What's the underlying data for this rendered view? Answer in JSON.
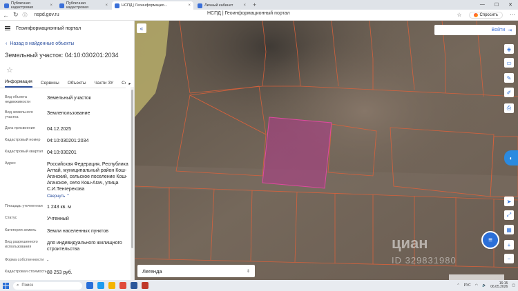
{
  "browser": {
    "tabs": [
      {
        "title": "Публичная кадастровая"
      },
      {
        "title": "Публичная кадастровая"
      },
      {
        "title": "НСПД | Геоинформацио...",
        "active": true
      },
      {
        "title": "Личный кабинет"
      }
    ],
    "url": "nspd.gov.ru",
    "page_title": "НСПД | Геоинформационный портал",
    "ask_label": "Спросить"
  },
  "panel": {
    "portal_name": "Геоинформационный портал",
    "back_label": "Назад в найденные объекты",
    "title": "Земельный участок: 04:10:030201:2034",
    "tabs": [
      "Информация",
      "Сервисы",
      "Объекты",
      "Части ЗУ",
      "Составе"
    ],
    "collapse_label": "Свернуть",
    "properties": [
      {
        "key": "Вид объекта недвижимости",
        "value": "Земельный участок"
      },
      {
        "key": "Вид земельного участка",
        "value": "Землепользование"
      },
      {
        "key": "Дата присвоения",
        "value": "04.12.2025"
      },
      {
        "key": "Кадастровый номер",
        "value": "04:10:030201:2034"
      },
      {
        "key": "Кадастровый квартал",
        "value": "04:10:030201"
      },
      {
        "key": "Адрес",
        "value": "Российская Федерация, Республика Алтай, муниципальный район Кош-Агачский, сельское поселение Кош-Агачское, село Кош-Агач, улица С.И.Тенгерекова"
      },
      {
        "key": "Площадь уточненная",
        "value": "1 243 кв. м"
      },
      {
        "key": "Статус",
        "value": "Учтенный"
      },
      {
        "key": "Категория земель",
        "value": "Земли населенных пунктов"
      },
      {
        "key": "Вид разрешенного использования",
        "value": "для индивидуального жилищного строительства"
      },
      {
        "key": "Форма собственности",
        "value": "-"
      },
      {
        "key": "Кадастровая стоимость",
        "value": "88 253 руб."
      }
    ]
  },
  "map": {
    "login_label": "Войти",
    "legend_label": "Легенда",
    "watermark_brand": "циан",
    "watermark_id": "ID 329831980",
    "colors": {
      "parcel_border": "#e0623a",
      "selected_fill": "#b03a8a",
      "accent": "#2b6fd8"
    }
  },
  "taskbar": {
    "search_placeholder": "Поиск",
    "lang": "РУС",
    "time": "16:15",
    "date": "06.05.2026"
  }
}
